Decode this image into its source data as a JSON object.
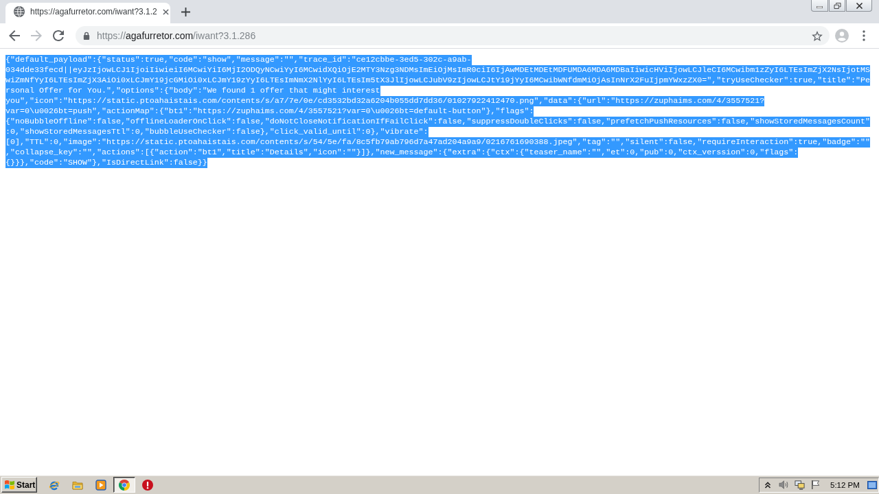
{
  "browser": {
    "tab": {
      "title": "https://agafurretor.com/iwant?3.1.2",
      "selected": true
    }
  },
  "navigation": [
    {
      "kind": "back",
      "disabled": false
    },
    {
      "kind": "forward",
      "disabled": true
    },
    {
      "kind": "reload",
      "disabled": false
    }
  ],
  "address": {
    "scheme": "https://",
    "host": "agafurretor.com",
    "path": "/iwant?3.1.286",
    "bookmarked": false
  },
  "page": {
    "selected": true,
    "lines": [
      "{\"default_payload\":{\"status\":true,\"code\":\"show\",\"message\":\"\",\"trace_id\":\"ce12cbbe-3ed5-302c-a9ab-",
      "034dde33fecd||eyJzIjowLCJ1IjoiIiwieiI6MCwiYiI6MjI2ODQyNCwiYyI6MCwidXQiOjE2MTY3Nzg3NDMsImEiOjMsImR0ciI6IjAwMDEtMDEtMDFUMDA6MDA6MDBaIiwicHViIjowLCJleCI6MCwibm1zZyI6LTEsImZjX2NsIjotMS",
      "wiZmNfYyI6LTEsImZjX3AiOi0xLCJmY19jcGMiOi0xLCJmY19zYyI6LTEsImNmX2NlYyI6LTEsIm5tX3JlIjowLCJubV9zIjowLCJtY19jYyI6MCwibWNfdmMiOjAsInNrX2FuIjpmYWxzZX0=\",\"tryUseChecker\":true,\"title\":\"Pe",
      "rsonal Offer for You.\",\"options\":{\"body\":\"We found 1 offer that might interest",
      "you\",\"icon\":\"https://static.ptoahaistais.com/contents/s/a7/7e/0e/cd3532bd32a6204b055dd7dd36/01027922412470.png\",\"data\":{\"url\":\"https://zuphaims.com/4/3557521?",
      "var=0\\u0026bt=push\",\"actionMap\":{\"bt1\":\"https://zuphaims.com/4/3557521?var=0\\u0026bt=default-button\"},\"flags\":",
      "{\"noBubbleOffline\":false,\"offlineLoaderOnClick\":false,\"doNotCloseNotificationIfFailClick\":false,\"suppressDoubleClicks\":false,\"prefetchPushResources\":false,\"showStoredMessagesCount\"",
      ":0,\"showStoredMessagesTtl\":0,\"bubbleUseChecker\":false},\"click_valid_until\":0},\"vibrate\":",
      "[0],\"TTL\":0,\"image\":\"https://static.ptoahaistais.com/contents/s/54/5e/fa/8c5fb79ab796d7a47ad204a9a9/0216761690388.jpeg\",\"tag\":\"\",\"silent\":false,\"requireInteraction\":true,\"badge\":\"\"",
      ",\"collapse_key\":\"\",\"actions\":[{\"action\":\"bt1\",\"title\":\"Details\",\"icon\":\"\"}]},\"new_message\":{\"extra\":{\"ctx\":{\"teaser_name\":\"\",\"et\":0,\"pub\":0,\"ctx_verssion\":0,\"flags\":",
      "{}}},\"code\":\"SHOW\"},\"IsDirectLink\":false}}"
    ]
  },
  "taskbar": {
    "start": "Start",
    "apps": [
      {
        "kind": "ie",
        "selected": false
      },
      {
        "kind": "folder",
        "selected": false
      },
      {
        "kind": "media",
        "selected": false
      },
      {
        "kind": "chrome",
        "selected": true
      },
      {
        "kind": "alert",
        "selected": false
      }
    ],
    "clock": "5:12 PM"
  }
}
